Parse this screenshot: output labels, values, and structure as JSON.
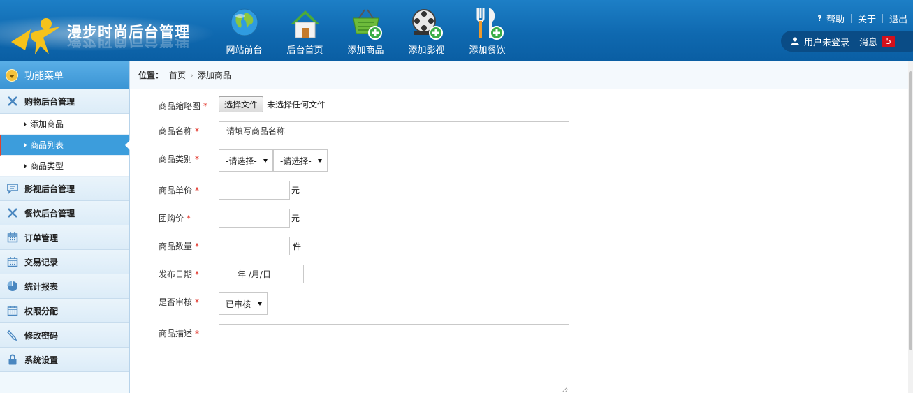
{
  "header": {
    "title": "漫步时尚后台管理",
    "nav": [
      {
        "label": "网站前台",
        "icon": "globe-icon"
      },
      {
        "label": "后台首页",
        "icon": "home-icon"
      },
      {
        "label": "添加商品",
        "icon": "basket-add-icon"
      },
      {
        "label": "添加影视",
        "icon": "film-reel-add-icon"
      },
      {
        "label": "添加餐饮",
        "icon": "fork-knife-add-icon"
      }
    ],
    "links": {
      "help": "帮助",
      "about": "关于",
      "logout": "退出"
    },
    "user": {
      "name": "用户未登录",
      "messages_label": "消息",
      "message_count": "5"
    }
  },
  "sidebar": {
    "menu_title": "功能菜单",
    "groups": [
      {
        "label": "购物后台管理",
        "icon": "cross-tools-icon"
      },
      {
        "label": "影视后台管理",
        "icon": "chat-icon"
      },
      {
        "label": "餐饮后台管理",
        "icon": "cross-tools-icon"
      },
      {
        "label": "订单管理",
        "icon": "calendar-icon"
      },
      {
        "label": "交易记录",
        "icon": "calendar-icon"
      },
      {
        "label": "统计报表",
        "icon": "pie-chart-icon"
      },
      {
        "label": "权限分配",
        "icon": "calendar-icon"
      },
      {
        "label": "修改密码",
        "icon": "pen-icon"
      },
      {
        "label": "系统设置",
        "icon": "lock-icon"
      }
    ],
    "sub_items": [
      "添加商品",
      "商品列表",
      "商品类型"
    ],
    "active_sub": "商品列表"
  },
  "breadcrumb": {
    "prefix": "位置：",
    "home": "首页",
    "current": "添加商品"
  },
  "form": {
    "thumbnail": {
      "label": "商品缩略图",
      "button": "选择文件",
      "status": "未选择任何文件"
    },
    "name": {
      "label": "商品名称",
      "value": "请填写商品名称"
    },
    "category": {
      "label": "商品类别",
      "select1": "-请选择-",
      "select2": "-请选择-"
    },
    "price": {
      "label": "商品单价",
      "value": "",
      "unit": "元"
    },
    "group_price": {
      "label": "团购价",
      "value": "",
      "unit": "元"
    },
    "quantity": {
      "label": "商品数量",
      "value": "",
      "unit": "件"
    },
    "publish_date": {
      "label": "发布日期",
      "value": "年 /月/日"
    },
    "audit": {
      "label": "是否审核",
      "value": "已审核"
    },
    "description": {
      "label": "商品描述",
      "value": ""
    },
    "required_mark": "*"
  },
  "colors": {
    "header": "#0f69b0",
    "sidebar_active": "#3c9ddc",
    "required": "#e0281c",
    "badge": "#d4101b"
  }
}
